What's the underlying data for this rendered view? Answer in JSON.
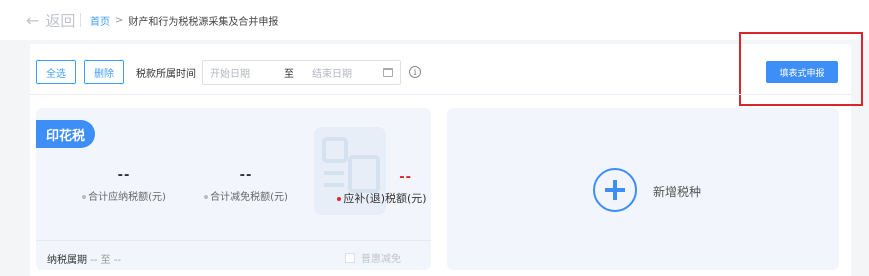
{
  "header": {
    "back_label": "返回",
    "breadcrumb": {
      "home": "首页",
      "separator": ">",
      "current": "财产和行为税税源采集及合并申报"
    }
  },
  "toolbar": {
    "select_all": "全选",
    "delete": "删除",
    "period_label": "税款所属时间",
    "start_placeholder": "开始日期",
    "range_separator": "至",
    "end_placeholder": "结束日期",
    "info_glyph": "i",
    "submit_button": "填表式申报"
  },
  "tax_card": {
    "tag": "印花税",
    "metrics": [
      {
        "value": "--",
        "label": "合计应纳税额(元)"
      },
      {
        "value": "--",
        "label": "合计减免税额(元)"
      },
      {
        "value": "--",
        "label": "应补(退)税额(元)"
      }
    ],
    "period_label": "纳税属期",
    "period_value": "-- 至 --",
    "checkbox_label": "普惠减免"
  },
  "add_card": {
    "label": "新增税种"
  },
  "colors": {
    "accent": "#3d8ef7",
    "highlight_box": "#d9262b",
    "due_value": "#e0242c"
  },
  "icons": [
    "back-arrow-icon",
    "calendar-icon",
    "info-icon",
    "plus-icon",
    "document-watermark-icon"
  ]
}
